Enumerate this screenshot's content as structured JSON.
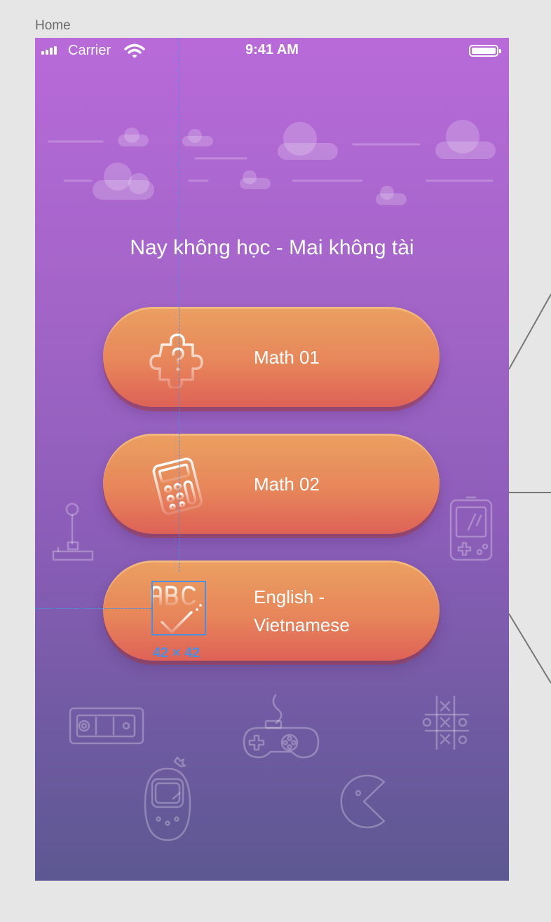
{
  "artboard": {
    "label": "Home"
  },
  "statusbar": {
    "carrier": "Carrier",
    "time": "9:41 AM"
  },
  "headline": "Nay không học - Mai không tài",
  "menu": [
    {
      "label": "Math 01",
      "icon": "puzzle-icon"
    },
    {
      "label": "Math 02",
      "icon": "calculator-icon"
    },
    {
      "label": "English - Vietnamese",
      "icon": "abc-check-icon"
    }
  ],
  "measure": {
    "label": "42 × 42"
  },
  "colors": {
    "bg_top": "#b86ad9",
    "bg_bottom": "#5d5891",
    "button_top": "#eba061",
    "button_bottom": "#de6257",
    "guide": "#4a90e2"
  }
}
